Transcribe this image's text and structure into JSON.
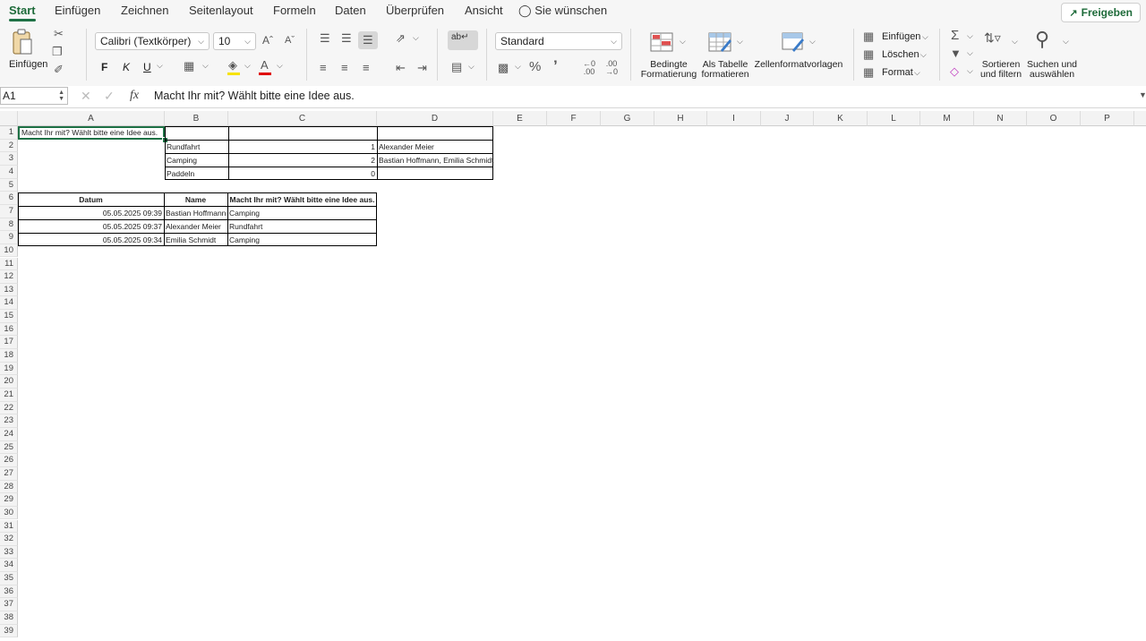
{
  "tabs": [
    "Start",
    "Einfügen",
    "Zeichnen",
    "Seitenlayout",
    "Formeln",
    "Daten",
    "Überprüfen",
    "Ansicht",
    "Sie wünschen"
  ],
  "share_label": "Freigeben",
  "ribbon": {
    "paste_label": "Einfügen",
    "font_name": "Calibri (Textkörper)",
    "font_size": "10",
    "bold": "F",
    "italic": "K",
    "underline": "U",
    "number_format": "Standard",
    "cond_format": [
      "Bedingte",
      "Formatierung"
    ],
    "as_table": [
      "Als Tabelle",
      "formatieren"
    ],
    "cell_styles": "Zellenformatvorlagen",
    "insert_cells": "Einfügen",
    "delete_cells": "Löschen",
    "format_cells": "Format",
    "sort_filter": [
      "Sortieren",
      "und filtern"
    ],
    "find_select": [
      "Suchen und",
      "auswählen"
    ]
  },
  "formula_bar": {
    "cell_ref": "A1",
    "fx": "fx",
    "content": "Macht Ihr mit? Wählt bitte eine Idee aus."
  },
  "columns": [
    "A",
    "B",
    "C",
    "D",
    "E",
    "F",
    "G",
    "H",
    "I",
    "J",
    "K",
    "L",
    "M",
    "N",
    "O",
    "P"
  ],
  "rows": [
    "1",
    "2",
    "3",
    "4",
    "5",
    "6",
    "7",
    "8",
    "9",
    "10",
    "11",
    "12",
    "13",
    "14",
    "15",
    "16",
    "17",
    "18",
    "19",
    "20",
    "21",
    "22",
    "23",
    "24",
    "25",
    "26",
    "27",
    "28",
    "29",
    "30",
    "31",
    "32",
    "33",
    "34",
    "35",
    "36",
    "37",
    "38",
    "39"
  ],
  "sheet": {
    "a1": "Macht Ihr mit? Wählt bitte eine Idee aus.",
    "options": [
      {
        "name": "Rundfahrt",
        "count": "1",
        "people": "Alexander Meier"
      },
      {
        "name": "Camping",
        "count": "2",
        "people": "Bastian Hoffmann, Emilia Schmidt"
      },
      {
        "name": "Paddeln",
        "count": "0",
        "people": ""
      }
    ],
    "table_headers": [
      "Datum",
      "Name",
      "Macht Ihr mit? Wählt bitte eine Idee aus."
    ],
    "responses": [
      [
        "05.05.2025 09:39",
        "Bastian Hoffmann",
        "Camping"
      ],
      [
        "05.05.2025 09:37",
        "Alexander Meier",
        "Rundfahrt"
      ],
      [
        "05.05.2025 09:34",
        "Emilia Schmidt",
        "Camping"
      ]
    ]
  }
}
